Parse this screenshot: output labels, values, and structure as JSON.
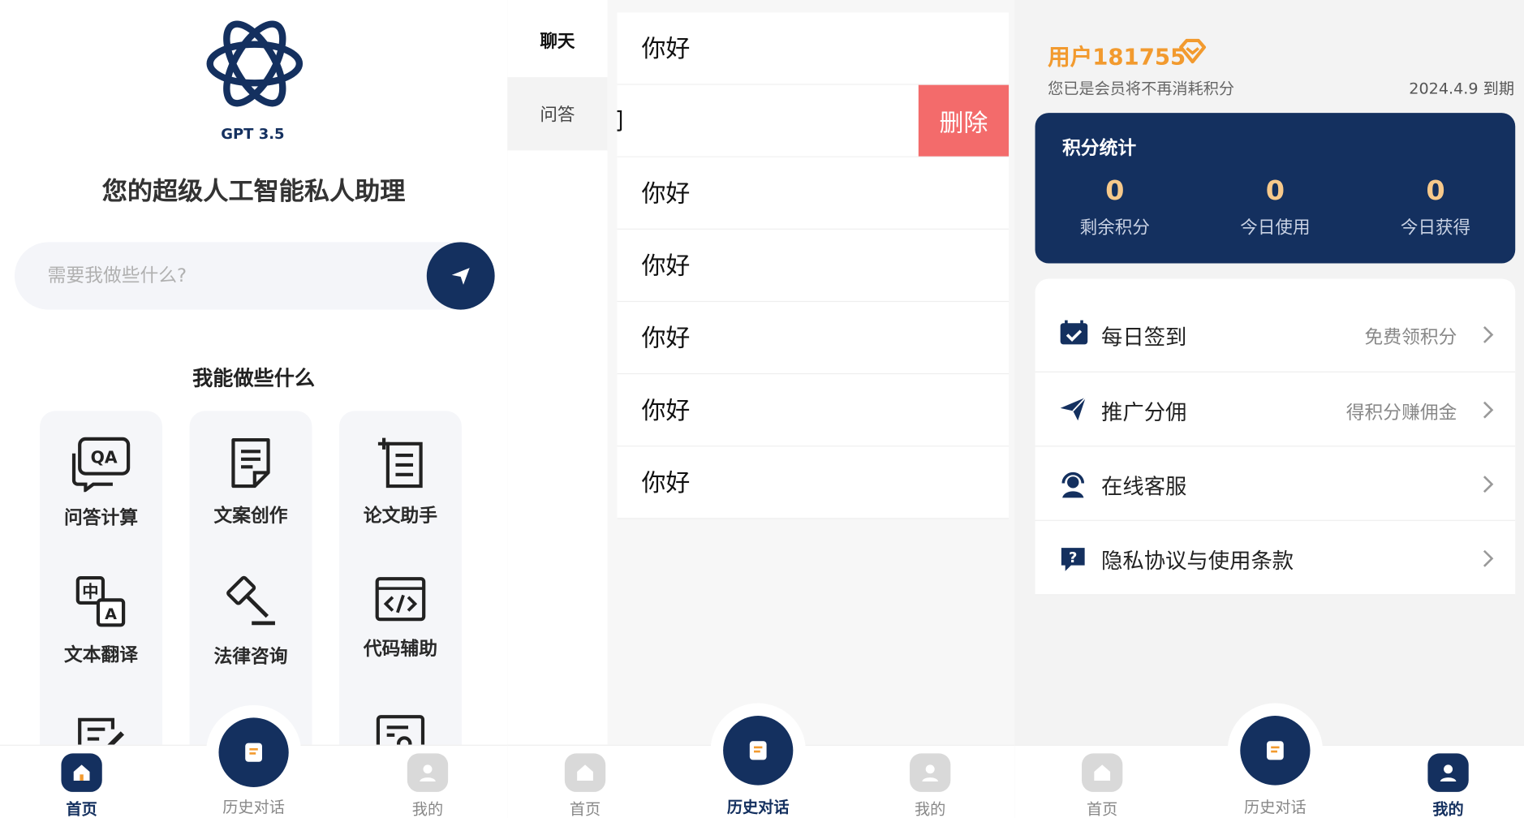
{
  "home": {
    "logo_text": "GPT 3.5",
    "tagline": "您的超级人工智能私人助理",
    "search_placeholder": "需要我做些什么?",
    "section_title": "我能做些什么",
    "features": [
      {
        "label": "问答计算",
        "icon": "qa-chat-icon"
      },
      {
        "label": "文案创作",
        "icon": "document-icon"
      },
      {
        "label": "论文助手",
        "icon": "paper-list-icon"
      },
      {
        "label": "文本翻译",
        "icon": "translate-icon"
      },
      {
        "label": "法律咨询",
        "icon": "gavel-icon"
      },
      {
        "label": "代码辅助",
        "icon": "code-window-icon"
      }
    ]
  },
  "history": {
    "sidebar": [
      "聊天",
      "问答"
    ],
    "chats": [
      "你好",
      "问",
      "你好",
      "你好",
      "你好",
      "你好",
      "你好"
    ],
    "delete_label": "删除"
  },
  "profile": {
    "username": "用户181755",
    "member_note": "您已是会员将不再消耗积分",
    "expiry": "2024.4.9 到期",
    "stats_title": "积分统计",
    "stats": [
      {
        "value": "0",
        "label": "剩余积分"
      },
      {
        "value": "0",
        "label": "今日使用"
      },
      {
        "value": "0",
        "label": "今日获得"
      }
    ],
    "menu": [
      {
        "label": "每日签到",
        "hint": "免费领积分",
        "icon": "calendar-check-icon"
      },
      {
        "label": "推广分佣",
        "hint": "得积分赚佣金",
        "icon": "paper-plane-icon"
      },
      {
        "label": "在线客服",
        "hint": "",
        "icon": "headset-agent-icon"
      },
      {
        "label": "隐私协议与使用条款",
        "hint": "",
        "icon": "help-bubble-icon"
      }
    ]
  },
  "tabbar": {
    "home": "首页",
    "history": "历史对话",
    "mine": "我的"
  },
  "colors": {
    "navy": "#14305f",
    "orange": "#f29a2e",
    "danger": "#f36b6b"
  }
}
